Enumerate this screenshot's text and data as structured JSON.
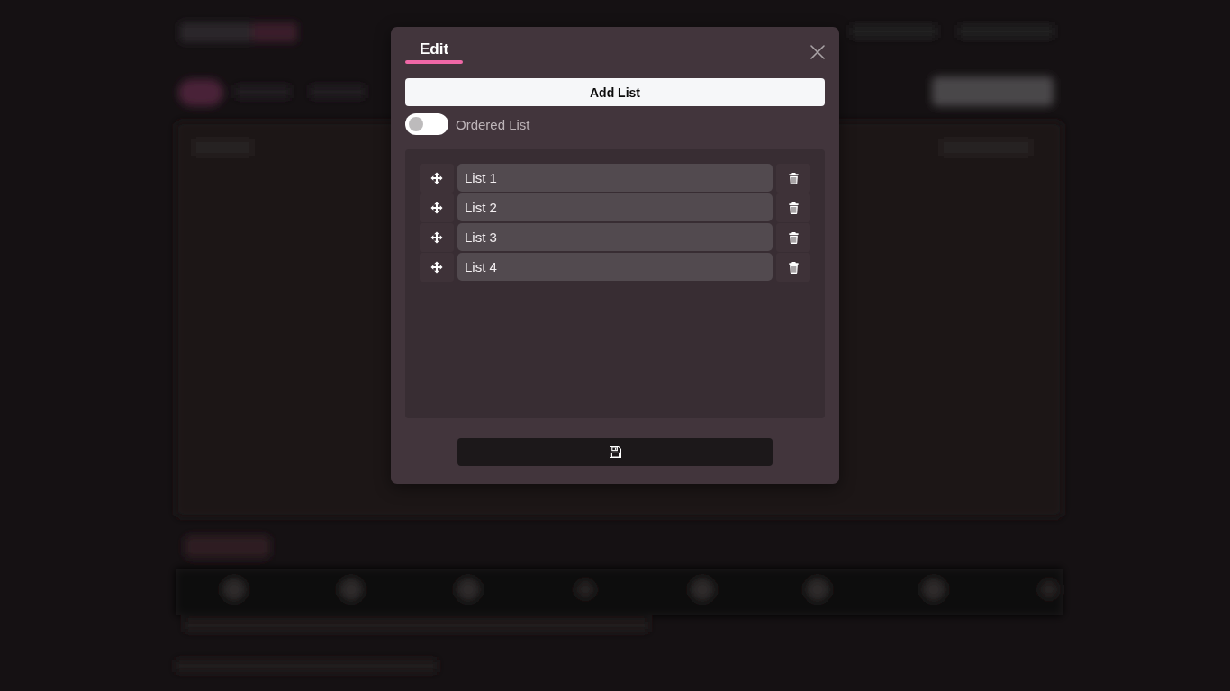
{
  "dialog": {
    "tabs": [
      {
        "label": "Edit",
        "selected": true
      }
    ],
    "add_button": "Add List",
    "ordered_list": {
      "label": "Ordered List",
      "on": false
    },
    "lists": [
      {
        "value": "List 1"
      },
      {
        "value": "List 2"
      },
      {
        "value": "List 3"
      },
      {
        "value": "List 4"
      }
    ]
  }
}
